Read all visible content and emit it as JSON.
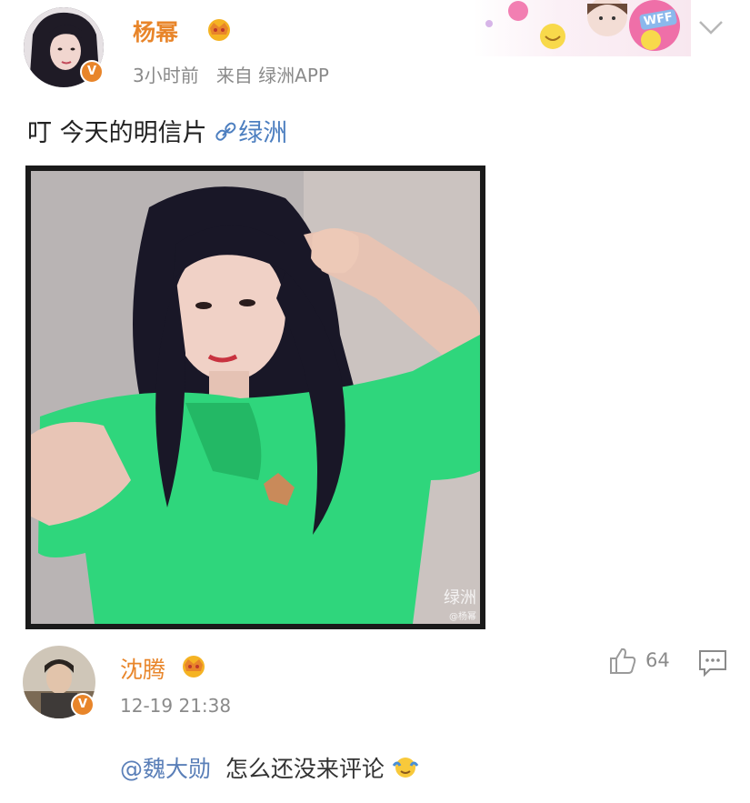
{
  "post": {
    "author": "杨幂",
    "time": "3小时前",
    "source_prefix": "来自",
    "source_app": "绿洲APP",
    "text": "叮 今天的明信片",
    "link_text": "绿洲",
    "watermark_main": "绿洲",
    "watermark_sub": "@杨幂"
  },
  "header": {
    "badge_text": "WFF"
  },
  "comment": {
    "author": "沈腾",
    "time": "12-19 21:38",
    "likes": "64",
    "mention": "@魏大勋",
    "text": "怎么还没来评论"
  },
  "colors": {
    "name_orange": "#e8852a",
    "link_blue": "#4d7fc0",
    "shirt_green": "#2fd67c",
    "meta_gray": "#8a8a8a"
  }
}
